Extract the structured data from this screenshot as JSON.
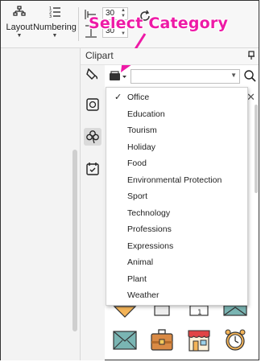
{
  "ribbon": {
    "layout_label": "Layout",
    "numbering_label": "Numbering",
    "spin_top_value": "30",
    "spin_bottom_value": "30"
  },
  "annotation": {
    "text": "Select Category",
    "color": "#ee1aa6"
  },
  "panel": {
    "title": "Clipart"
  },
  "search": {
    "value": ""
  },
  "menu": {
    "selected": "Office",
    "items": [
      {
        "label": "Office",
        "checked": true
      },
      {
        "label": "Education",
        "checked": false
      },
      {
        "label": "Tourism",
        "checked": false
      },
      {
        "label": "Holiday",
        "checked": false
      },
      {
        "label": "Food",
        "checked": false
      },
      {
        "label": "Environmental Protection",
        "checked": false
      },
      {
        "label": "Sport",
        "checked": false
      },
      {
        "label": "Technology",
        "checked": false
      },
      {
        "label": "Professions",
        "checked": false
      },
      {
        "label": "Expressions",
        "checked": false
      },
      {
        "label": "Animal",
        "checked": false
      },
      {
        "label": "Plant",
        "checked": false
      },
      {
        "label": "Weather",
        "checked": false
      }
    ]
  },
  "colors": {
    "accent": "#ee1aa6",
    "selected_icon_bg": "#dadada"
  },
  "icons": {
    "side": [
      "paint-bucket-icon",
      "flower-frame-icon",
      "clover-icon",
      "calendar-icon"
    ],
    "clipart_row1": [
      "package-icon",
      "paper-icon",
      "calendar-page-icon",
      "envelope-icon"
    ],
    "clipart_row2": [
      "envelope-icon",
      "briefcase-icon",
      "shop-icon",
      "alarm-clock-icon"
    ]
  }
}
